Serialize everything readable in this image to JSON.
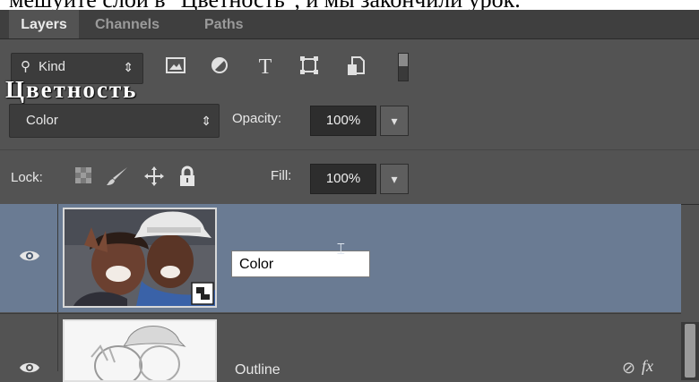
{
  "caption": "мешуйте слой в \"Цветность\", и мы закончили урок.",
  "overlay_word": "Цветность",
  "tabs": [
    {
      "label": "Layers",
      "active": true
    },
    {
      "label": "Channels",
      "active": false
    },
    {
      "label": "Paths",
      "active": false
    }
  ],
  "filter": {
    "kind_label": "Kind",
    "icons": [
      "image-filter-icon",
      "adjustment-filter-icon",
      "type-filter-icon",
      "shape-filter-icon",
      "smart-object-filter-icon",
      "filter-toggle-icon"
    ]
  },
  "blend": {
    "mode": "Color",
    "opacity_label": "Opacity:",
    "opacity_value": "100%"
  },
  "lock": {
    "label": "Lock:",
    "icons": [
      "lock-transparent-icon",
      "lock-brush-icon",
      "lock-position-icon",
      "lock-all-icon"
    ],
    "fill_label": "Fill:",
    "fill_value": "100%"
  },
  "layers": [
    {
      "name": "Color",
      "selected": true,
      "editing": true,
      "visible": true
    },
    {
      "name": "Outline",
      "selected": false,
      "editing": false,
      "visible": true
    }
  ],
  "colors": {
    "panel_bg": "#535353",
    "selected_row": "#6a7b93",
    "field_bg": "#2d2d2d"
  }
}
